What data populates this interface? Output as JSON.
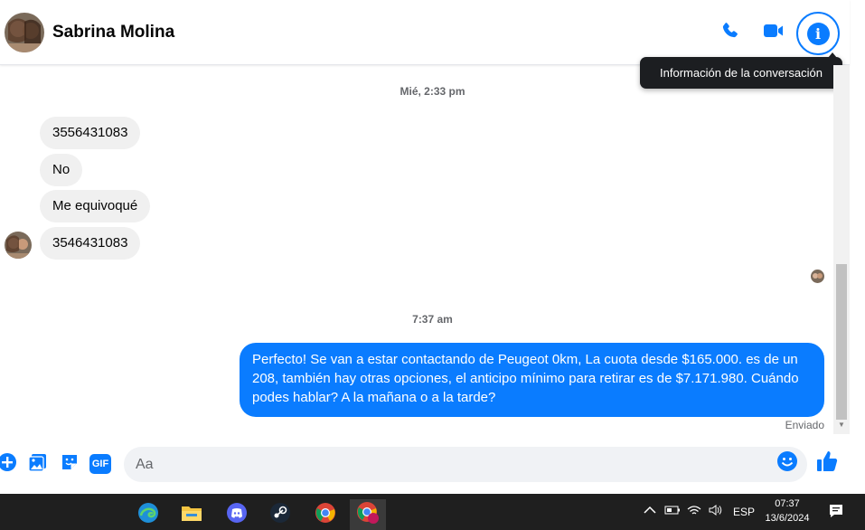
{
  "header": {
    "contact_name": "Sabrina Molina",
    "call_icon": "phone-icon",
    "video_icon": "video-camera-icon",
    "info_icon": "info-icon"
  },
  "tooltip": {
    "text": "Información de la conversación"
  },
  "conversation": {
    "timestamp_1": "Mié, 2:33 pm",
    "incoming": [
      {
        "text": "3556431083"
      },
      {
        "text": "No"
      },
      {
        "text": "Me equivoqué"
      },
      {
        "text": "3546431083"
      }
    ],
    "timestamp_2": "7:37 am",
    "outgoing": {
      "text": "Perfecto!  Se van a estar contactando de Peugeot 0km, La cuota desde $165.000. es de un 208, también hay otras opciones, el anticipo mínimo para retirar es de $7.171.980. Cuándo podes hablar? A la mañana o a la tarde?",
      "status": "Enviado"
    }
  },
  "composer": {
    "placeholder": "Aa",
    "icons": [
      "plus-icon",
      "photo-icon",
      "sticker-icon",
      "gif-icon",
      "emoji-icon",
      "like-icon"
    ],
    "gif_label": "GIF"
  },
  "taskbar": {
    "apps": [
      "edge-icon",
      "file-explorer-icon",
      "discord-icon",
      "steam-icon",
      "chrome-icon",
      "chrome-profile-icon"
    ],
    "language": "ESP",
    "time": "07:37",
    "date": "13/6/2024"
  },
  "colors": {
    "accent": "#0a7cff",
    "incoming_bubble": "#f0f0f0",
    "taskbar": "#1f1f1f"
  }
}
